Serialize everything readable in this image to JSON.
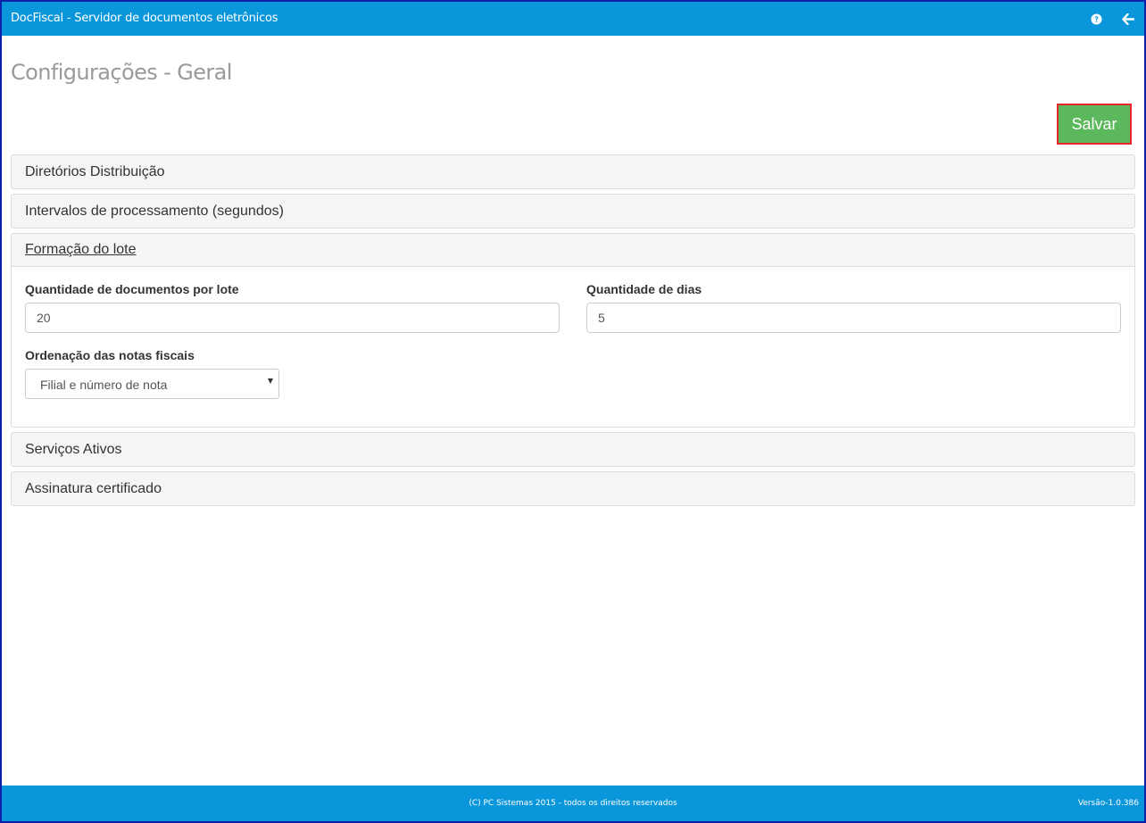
{
  "app": {
    "title": "DocFiscal - Servidor de documentos eletrônicos",
    "help_icon": "question-circle-icon",
    "back_icon": "arrow-left-icon"
  },
  "page": {
    "title": "Configurações - Geral"
  },
  "toolbar": {
    "save_label": "Salvar"
  },
  "panels": [
    {
      "title": "Diretórios Distribuição",
      "expanded": false
    },
    {
      "title": "Intervalos de processamento (segundos)",
      "expanded": false
    },
    {
      "title": "Formação do lote",
      "expanded": true
    },
    {
      "title": "Serviços Ativos",
      "expanded": false
    },
    {
      "title": "Assinatura certificado",
      "expanded": false
    }
  ],
  "lote": {
    "docs_per_batch_label": "Quantidade de documentos por lote",
    "docs_per_batch_value": "20",
    "days_label": "Quantidade de dias",
    "days_value": "5",
    "ordering_label": "Ordenação das notas fiscais",
    "ordering_selected": "Filial e número de nota"
  },
  "footer": {
    "copyright": "(C) PC Sistemas 2015 - todos os direitos reservados",
    "version": "Versão-1.0.386"
  },
  "colors": {
    "header_blue": "#0996db",
    "save_green": "#5cb85c",
    "save_border_red": "#e5262a",
    "frame_border": "#0a20a8"
  }
}
